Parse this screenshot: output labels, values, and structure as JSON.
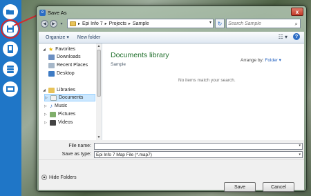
{
  "dialog": {
    "title": "Save As",
    "close_glyph": "x",
    "breadcrumb": [
      "Epi Info 7",
      "Projects",
      "Sample"
    ],
    "search_placeholder": "Search Sample",
    "toolbar": {
      "organize": "Organize ▾",
      "new_folder": "New folder",
      "views_glyph": "☷ ▾",
      "help_glyph": "?"
    },
    "nav": {
      "favorites": {
        "label": "Favorites",
        "items": [
          "Downloads",
          "Recent Places",
          "Desktop"
        ]
      },
      "libraries": {
        "label": "Libraries",
        "items": [
          "Documents",
          "Music",
          "Pictures",
          "Videos"
        ]
      },
      "selected": "Documents"
    },
    "content": {
      "library_title": "Documents library",
      "library_sub": "Sample",
      "arrange_label": "Arrange by:",
      "arrange_value": "Folder ▾",
      "empty_message": "No items match your search."
    },
    "fields": {
      "file_name_label": "File name:",
      "file_name_value": "",
      "save_type_label": "Save as type:",
      "save_type_value": "Epi Info 7 Map File (*.map7)"
    },
    "footer": {
      "hide_folders": "Hide Folders",
      "save": "Save",
      "cancel": "Cancel"
    }
  },
  "app_toolbar": {
    "icons": [
      "open-folder-icon",
      "save-icon",
      "save-as-icon",
      "database-icon",
      "map-icon"
    ]
  },
  "colors": {
    "app_bar": "#1f76c7",
    "highlight_ring": "#d8262c",
    "library_title": "#1e6e2a"
  }
}
